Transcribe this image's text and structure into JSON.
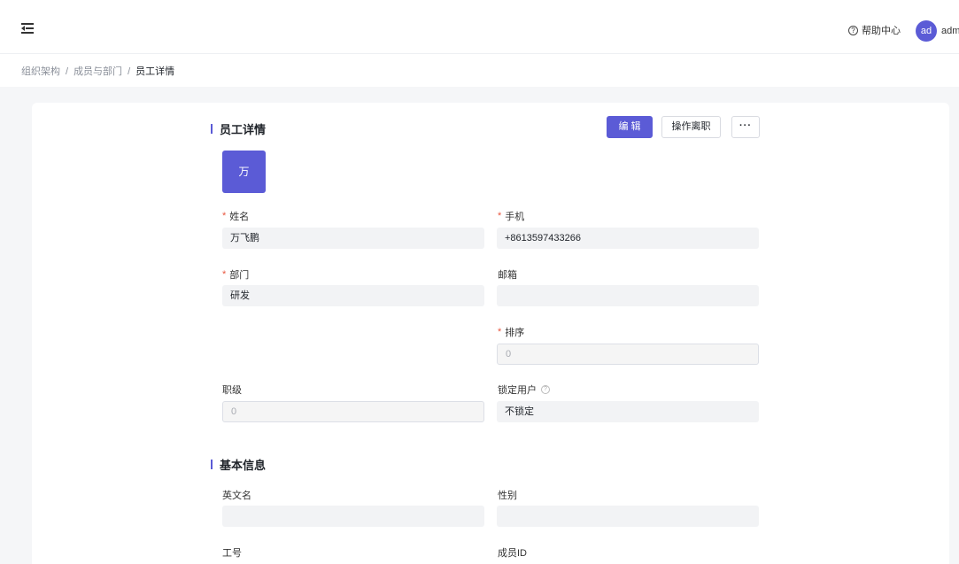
{
  "header": {
    "help_label": "帮助中心",
    "help_icon": "question-circle-icon",
    "avatar_text": "ad",
    "username": "adm"
  },
  "breadcrumb": {
    "items": [
      "组织架构",
      "成员与部门",
      "员工详情"
    ],
    "separator": "/"
  },
  "detail": {
    "section_title": "员工详情",
    "buttons": {
      "edit": "编 辑",
      "resign": "操作离职",
      "more": "···"
    },
    "avatar_char": "万",
    "fields": {
      "name": {
        "label": "姓名",
        "value": "万飞鹏",
        "required": true
      },
      "phone": {
        "label": "手机",
        "value": "+8613597433266",
        "required": true
      },
      "department": {
        "label": "部门",
        "value": "研发",
        "required": true
      },
      "email": {
        "label": "邮箱",
        "value": "",
        "required": false
      },
      "sort": {
        "label": "排序",
        "value": "0",
        "required": true
      },
      "rank": {
        "label": "职级",
        "value": "0",
        "required": false
      },
      "lock_user": {
        "label": "锁定用户",
        "value": "不锁定",
        "required": false
      }
    }
  },
  "basic_info": {
    "section_title": "基本信息",
    "fields": {
      "english_name": {
        "label": "英文名",
        "value": ""
      },
      "gender": {
        "label": "性别",
        "value": ""
      },
      "employee_no": {
        "label": "工号",
        "value": ""
      },
      "member_id": {
        "label": "成员ID",
        "value": ""
      }
    }
  },
  "colors": {
    "accent": "#5b5bd6",
    "required_mark": "#e8563f",
    "field_bg": "#f2f3f5",
    "page_bg": "#f5f6f8"
  }
}
